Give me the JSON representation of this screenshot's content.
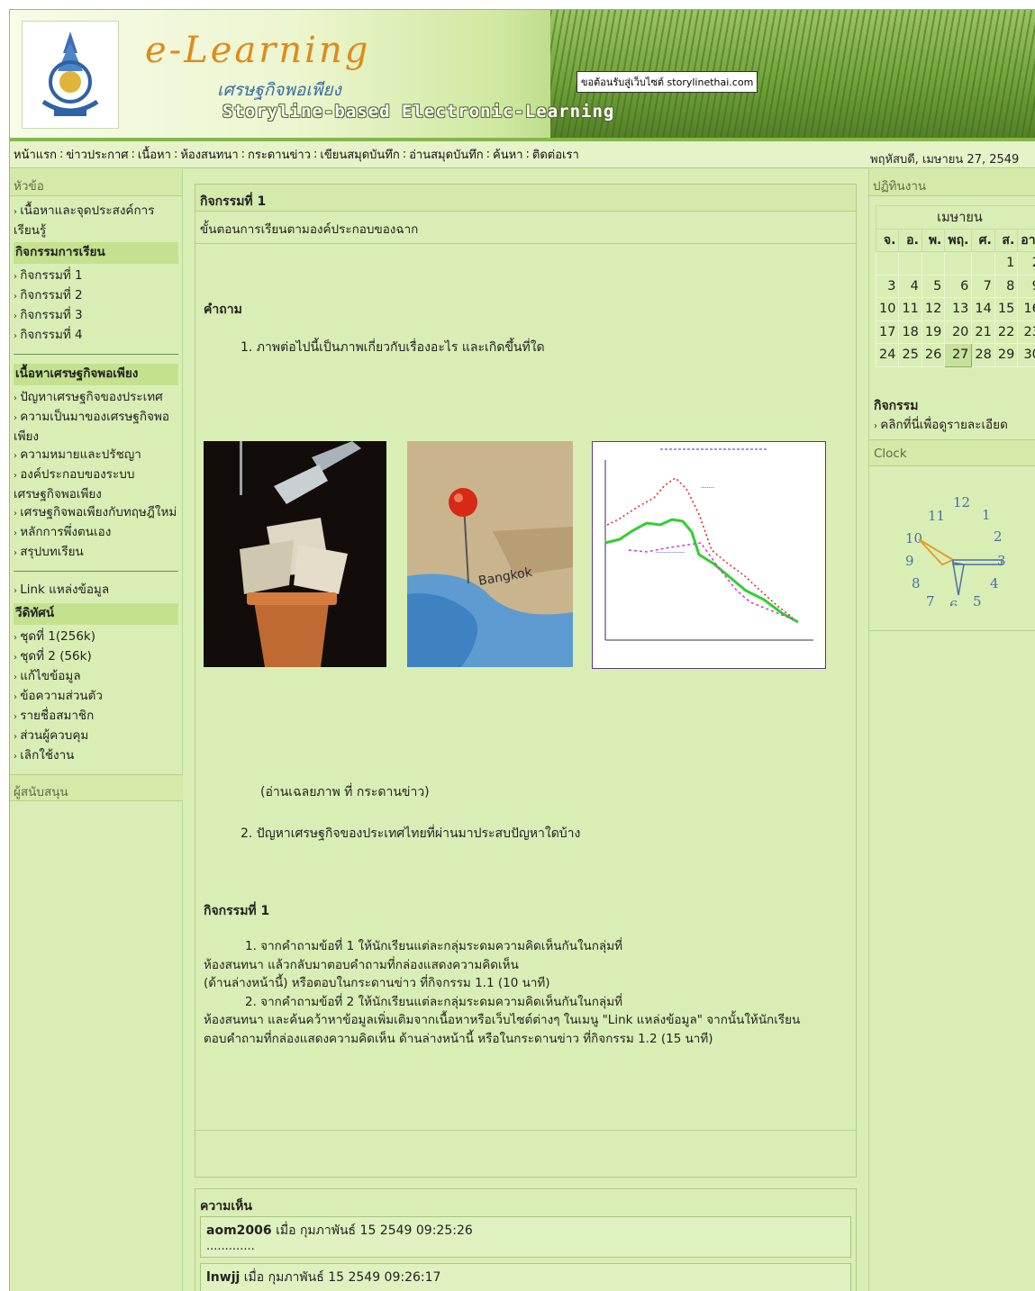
{
  "header": {
    "title": "e-Learning",
    "subtitle": "เศรษฐกิจพอเพียง",
    "tagline": "Storyline-based Electronic-Learning",
    "welcome": "ขอต้อนรับสู่เว็บไซต์ storylinethai.com"
  },
  "nav": {
    "items": [
      "หน้าแรก",
      "ข่าวประกาศ",
      "เนื้อหา",
      "ห้องสนทนา",
      "กระดานข่าว",
      "เขียนสมุดบันทึก",
      "อ่านสมุดบันทึก",
      "ค้นหา",
      "ติดต่อเรา"
    ],
    "separator": ":",
    "date": "พฤหัสบดี, เมษายน 27, 2549"
  },
  "left": {
    "title": "หัวข้อ",
    "intro": "เนื้อหาและจุดประสงค์การเรียนรู้",
    "learning_section": "กิจกรรมการเรียน",
    "activities": [
      "กิจกรรมที่ 1",
      "กิจกรรมที่ 2",
      "กิจกรรมที่ 3",
      "กิจกรรมที่ 4"
    ],
    "content_section": "เนื้อหาเศรษฐกิจพอเพียง",
    "content_items": [
      "ปัญหาเศรษฐกิจของประเทศ",
      "ความเป็นมาของเศรษฐกิจพอเพียง",
      "ความหมายและปรัชญา",
      "องค์ประกอบของระบบเศรษฐกิจพอเพียง",
      "เศรษฐกิจพอเพียงกับทฤษฎีใหม่",
      "หลักการพึ่งตนเอง",
      "สรุปบทเรียน"
    ],
    "link": "Link แหล่งข้อมูล",
    "video_section": "วีดิทัศน์",
    "video_items": [
      "ชุดที่ 1(256k)",
      "ชุดที่ 2 (56k)"
    ],
    "user_items": [
      "แก้ไขข้อมูล",
      "ข้อความส่วนตัว",
      "รายชื่อสมาชิก",
      "ส่วนผู้ควบคุม",
      "เลิกใช้งาน"
    ],
    "sponsor": "ผู้สนับสนุน"
  },
  "main": {
    "heading": "กิจกรรมที่ 1",
    "subheading": "ขั้นตอนการเรียนตามองค์ประกอบของฉาก",
    "question_title": "คำถาม",
    "question1": "1. ภาพต่อไปนี้เป็นภาพเกี่ยวกับเรื่องอะไร และเกิดขึ้นที่ใด",
    "map_label": "Bangkok",
    "caption": "(อ่านเฉลยภาพ ที่ กระดานข่าว)",
    "question2": "2. ปัญหาเศรษฐกิจของประเทศไทยที่ผ่านมาประสบปัญหาใดบ้าง",
    "activity_title": "กิจกรรมที่ 1",
    "activity_lines": [
      "1. จากคำถามข้อที่ 1 ให้นักเรียนแต่ละกลุ่มระดมความคิดเห็นกันในกลุ่มที่",
      "ห้องสนทนา แล้วกลับมาตอบคำถามที่กล่องแสดงความคิดเห็น",
      "(ด้านล่างหน้านี้) หรือตอบในกระดานข่าว ที่กิจกรรม 1.1 (10 นาที)",
      "2. จากคำถามข้อที่ 2 ให้นักเรียนแต่ละกลุ่มระดมความคิดเห็นกันในกลุ่มที่",
      "ห้องสนทนา และค้นคว้าหาข้อมูลเพิ่มเติมจากเนื้อหาหรือเว็บไซต์ต่างๆ ในเมนู \"Link แหล่งข้อมูล\" จากนั้นให้นักเรียน",
      "ตอบคำถามที่กล่องแสดงความคิดเห็น ด้านล่างหน้านี้ หรือในกระดานข่าว ที่กิจกรรม 1.2 (15 นาที)"
    ]
  },
  "comments": {
    "title": "ความเห็น",
    "items": [
      {
        "user": "aom2006",
        "meta": "เมื่อ กุมภาพันธ์ 15 2549 09:25:26",
        "body": "............."
      },
      {
        "user": "lnwjj",
        "meta": "เมื่อ กุมภาพันธ์ 15 2549 09:26:17",
        "body": ""
      }
    ]
  },
  "right": {
    "title": "ปฏิทินงาน",
    "calendar": {
      "month": "เมษายน",
      "days": [
        "จ.",
        "อ.",
        "พ.",
        "พฤ.",
        "ศ.",
        "ส.",
        "อา."
      ],
      "weeks": [
        [
          "",
          "",
          "",
          "",
          "",
          "1",
          "2"
        ],
        [
          "3",
          "4",
          "5",
          "6",
          "7",
          "8",
          "9"
        ],
        [
          "10",
          "11",
          "12",
          "13",
          "14",
          "15",
          "16"
        ],
        [
          "17",
          "18",
          "19",
          "20",
          "21",
          "22",
          "23"
        ],
        [
          "24",
          "25",
          "26",
          "27",
          "28",
          "29",
          "30"
        ]
      ],
      "today": "27"
    },
    "activity_title": "กิจกรรม",
    "activity_link": "คลิกที่นี่เพื่อดูรายละเอียด",
    "clock_title": "Clock",
    "clock_numbers": [
      "12",
      "1",
      "2",
      "3",
      "4",
      "5",
      "6",
      "7",
      "8",
      "9",
      "10",
      "11"
    ]
  },
  "colors": {
    "page_bg": "#d9eeb4",
    "section_bg": "#c4e18e",
    "nav_accent": "#86b54d",
    "title_orange": "#e08a1a"
  }
}
